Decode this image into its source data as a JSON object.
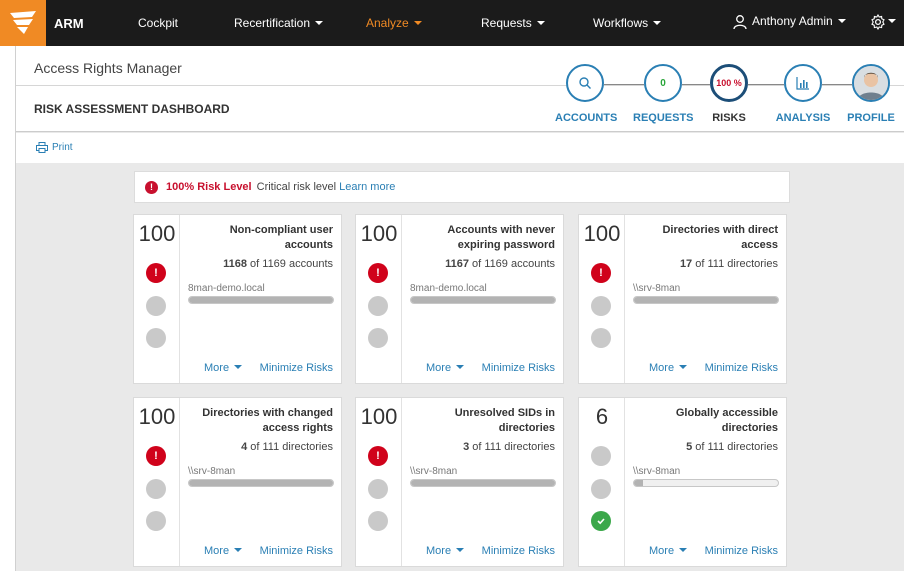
{
  "topbar": {
    "brand": "ARM",
    "nav": [
      {
        "label": "Cockpit",
        "caret": false,
        "active": false
      },
      {
        "label": "Recertification",
        "caret": true,
        "active": false
      },
      {
        "label": "Analyze",
        "caret": true,
        "active": true
      },
      {
        "label": "Requests",
        "caret": true,
        "active": false
      },
      {
        "label": "Workflows",
        "caret": true,
        "active": false
      }
    ],
    "user": "Anthony Admin",
    "accent": "#f08a24"
  },
  "header": {
    "app_title": "Access Rights Manager",
    "page_title": "RISK ASSESSMENT DASHBOARD",
    "steps": [
      {
        "label": "ACCOUNTS",
        "icon": "search-icon",
        "value": ""
      },
      {
        "label": "REQUESTS",
        "icon": "",
        "value": "0"
      },
      {
        "label": "RISKS",
        "icon": "",
        "value": "100 %"
      },
      {
        "label": "ANALYSIS",
        "icon": "bar-chart-icon",
        "value": ""
      },
      {
        "label": "PROFILE",
        "icon": "avatar",
        "value": ""
      }
    ]
  },
  "toolbar": {
    "print_label": "Print"
  },
  "risk": {
    "level": "100% Risk Level",
    "desc": "Critical risk level",
    "learn": "Learn more"
  },
  "cards": [
    {
      "score": "100",
      "title": "Non-compliant user accounts",
      "count": "1168",
      "total": "of 1169 accounts",
      "domain": "8man-demo.local",
      "fraction": 1.0,
      "level": "red"
    },
    {
      "score": "100",
      "title": "Accounts with never expiring password",
      "count": "1167",
      "total": "of 1169 accounts",
      "domain": "8man-demo.local",
      "fraction": 1.0,
      "level": "red"
    },
    {
      "score": "100",
      "title": "Directories with direct access",
      "count": "17",
      "total": "of 111 directories",
      "domain": "\\\\srv-8man",
      "fraction": 1.0,
      "level": "red"
    },
    {
      "score": "100",
      "title": "Directories with changed access rights",
      "count": "4",
      "total": "of 111 directories",
      "domain": "\\\\srv-8man",
      "fraction": 1.0,
      "level": "red"
    },
    {
      "score": "100",
      "title": "Unresolved SIDs in directories",
      "count": "3",
      "total": "of 111 directories",
      "domain": "\\\\srv-8man",
      "fraction": 1.0,
      "level": "red"
    },
    {
      "score": "6",
      "title": "Globally accessible directories",
      "count": "5",
      "total": "of 111 directories",
      "domain": "\\\\srv-8man",
      "fraction": 0.06,
      "level": "green"
    }
  ],
  "card_actions": {
    "more": "More",
    "minimize": "Minimize Risks"
  }
}
